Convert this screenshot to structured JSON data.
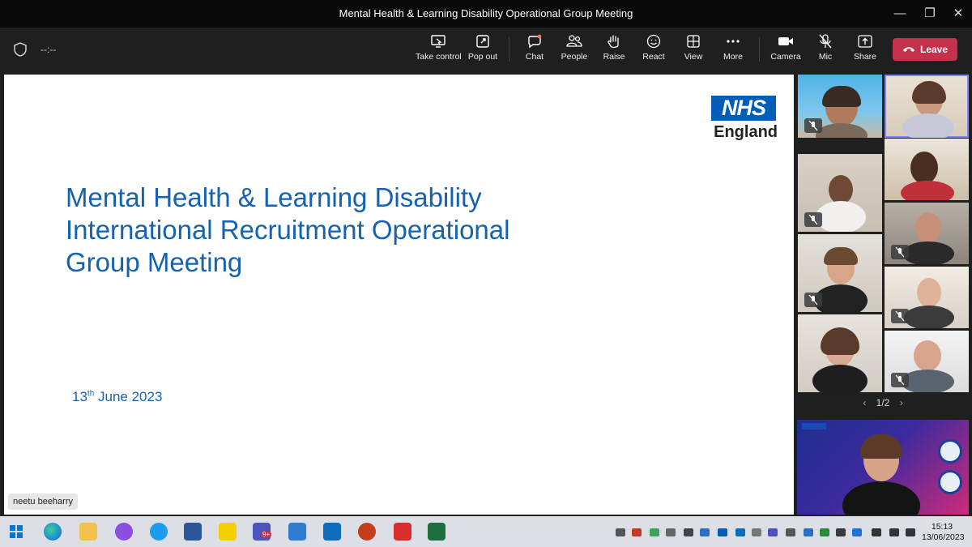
{
  "window": {
    "title": "Mental Health & Learning Disability Operational Group Meeting",
    "minimize_glyph": "—",
    "maximize_glyph": "❐",
    "close_glyph": "✕"
  },
  "toolbar": {
    "timer": "--:--",
    "take_control": "Take control",
    "pop_out": "Pop out",
    "chat": "Chat",
    "people": "People",
    "raise": "Raise",
    "react": "React",
    "view": "View",
    "more": "More",
    "camera": "Camera",
    "mic": "Mic",
    "share": "Share",
    "leave": "Leave",
    "leave_color": "#c4314b"
  },
  "slide": {
    "logo_mark": "NHS",
    "logo_sub": "England",
    "title_line1": "Mental Health & Learning Disability",
    "title_line2": "International Recruitment Operational",
    "title_line3": "Group Meeting",
    "date_day": "13",
    "date_suffix": "th",
    "date_rest": " June 2023",
    "accent_color": "#1462b0",
    "nhs_blue": "#005eb8"
  },
  "presenter": {
    "name": "neetu beeharry"
  },
  "gallery": {
    "pager": "1/2",
    "prev_glyph": "‹",
    "next_glyph": "›",
    "active_tile": 2
  },
  "taskbar": {
    "teams_badge": "9+",
    "time": "15:13",
    "date": "13/06/2023"
  }
}
